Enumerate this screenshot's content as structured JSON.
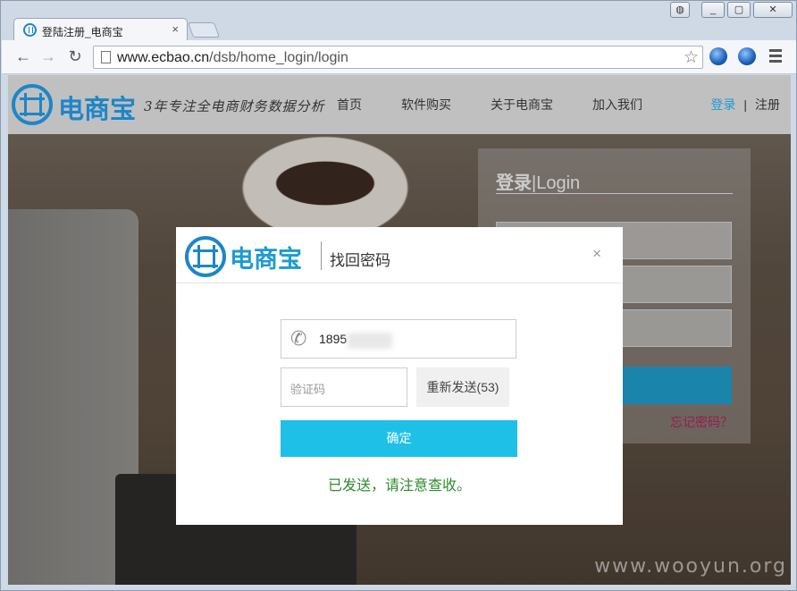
{
  "browser": {
    "tab_title": "登陆注册_电商宝",
    "tab_close": "×",
    "url_host": "www.ecbao.cn",
    "url_path": "/dsb/home_login/login",
    "window_buttons": {
      "minimize": "▭",
      "restore": "▢",
      "close": "✕"
    }
  },
  "site": {
    "logo_text": "电商宝",
    "slogan": "3年专注全电商财务数据分析",
    "nav": [
      "首页",
      "软件购买",
      "关于电商宝",
      "加入我们"
    ],
    "login": "登录",
    "separator": "|",
    "register": "注册"
  },
  "login_panel": {
    "title_cn": "登录",
    "title_sep": "|",
    "title_en": "Login",
    "forgot": "忘记密码？"
  },
  "watermark": "www.wooyun.org",
  "modal": {
    "logo_text": "电商宝",
    "title": "找回密码",
    "close": "×",
    "phone_value": "1895",
    "code_placeholder": "验证码",
    "resend": "重新发送(53)",
    "confirm": "确定",
    "message": "已发送，请注意查收。"
  }
}
